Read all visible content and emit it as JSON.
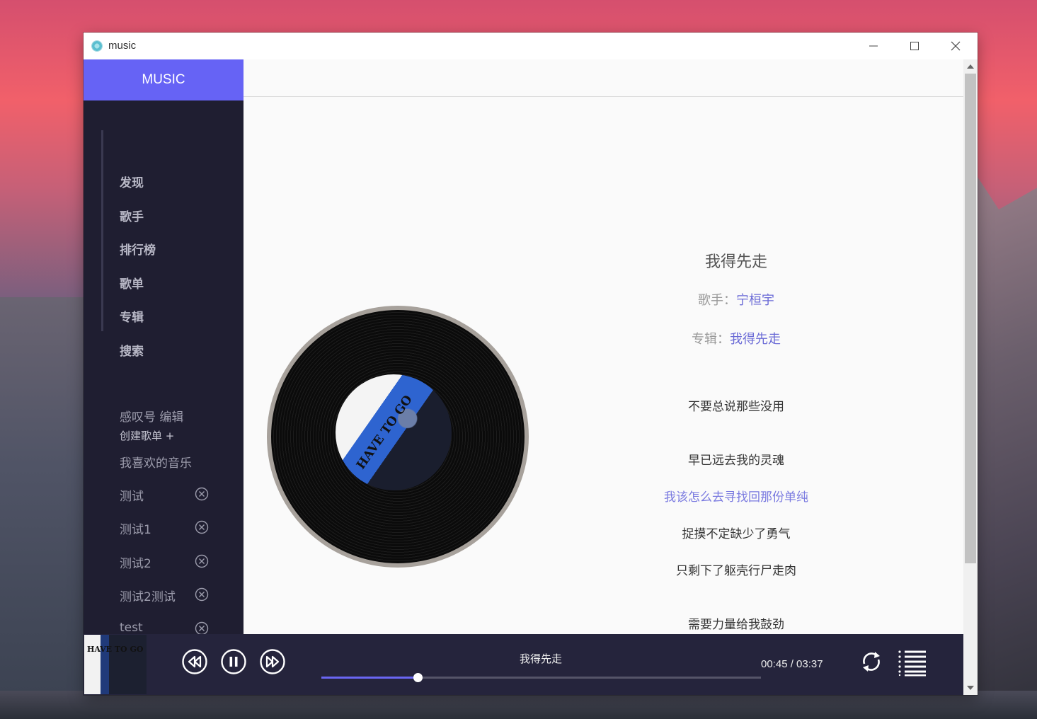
{
  "window": {
    "title": "music"
  },
  "brand": "MUSIC",
  "nav": {
    "items": [
      "发现",
      "歌手",
      "排行榜",
      "歌单",
      "专辑",
      "搜索"
    ]
  },
  "sidebar": {
    "edit_label": "感叹号 编辑",
    "create_playlist": "创建歌单 +",
    "favorites": "我喜欢的音乐",
    "playlists": [
      "测试",
      "测试1",
      "测试2",
      "测试2测试",
      "test"
    ]
  },
  "song": {
    "title": "我得先走",
    "artist_label": "歌手：",
    "artist": "宁桓宇",
    "album_label": "专辑：",
    "album": "我得先走",
    "cover_text": "HAVE TO GO"
  },
  "lyrics": {
    "lines": [
      "不要总说那些没用",
      "早已远去我的灵魂",
      "我该怎么去寻找回那份单纯",
      "捉摸不定缺少了勇气",
      "只剩下了躯壳行尸走肉",
      "需要力量给我鼓劲"
    ],
    "active_line": "我该怎么去寻找回那份单纯"
  },
  "player": {
    "now_playing": "我得先走",
    "time": "00:45 / 03:37",
    "progress": 0.219
  },
  "colors": {
    "accent": "#6663f5",
    "sidebar_bg": "#1f1e31",
    "player_bg": "#25243c",
    "link": "#6a6ad6"
  },
  "icons": {
    "previous": "rewind-icon",
    "pause": "pause-icon",
    "next": "fast-forward-icon",
    "loop": "loop-icon",
    "playlist": "list-icon",
    "delete": "close-circle-icon"
  }
}
